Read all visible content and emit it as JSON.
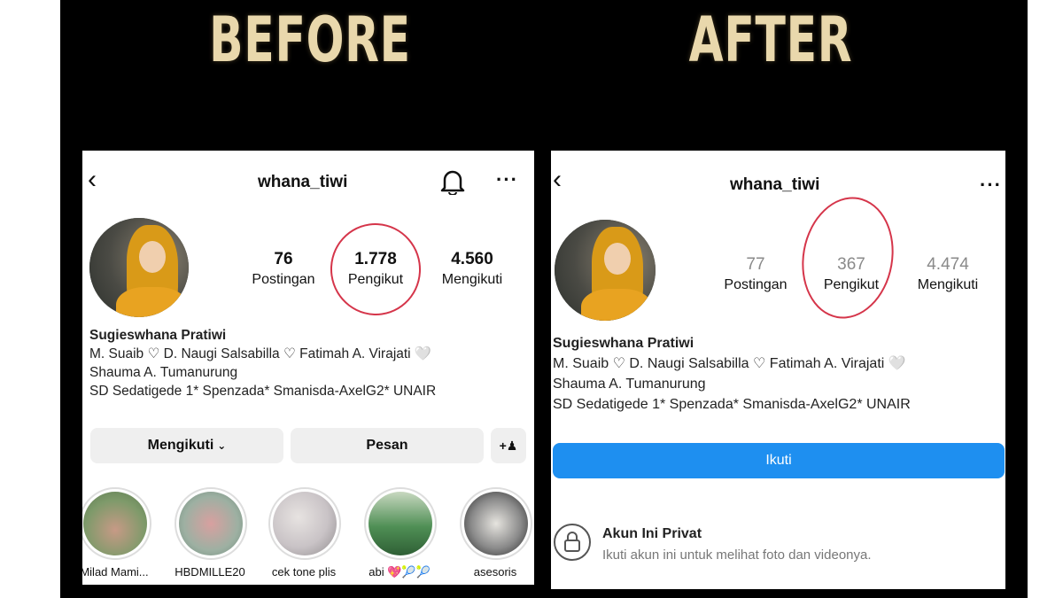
{
  "headings": {
    "before": "BEFORE",
    "after": "AFTER"
  },
  "before": {
    "username": "whana_tiwi",
    "stats": [
      {
        "value": "76",
        "label": "Postingan"
      },
      {
        "value": "1.778",
        "label": "Pengikut"
      },
      {
        "value": "4.560",
        "label": "Mengikuti"
      }
    ],
    "bio": {
      "name": "Sugieswhana Pratiwi",
      "line1": "M. Suaib ♡ D. Naugi Salsabilla ♡ Fatimah A. Virajati 🤍",
      "line2": "Shauma A. Tumanurung",
      "line3": "SD Sedatigede 1* Spenzada* Smanisda-AxelG2* UNAIR"
    },
    "buttons": {
      "following": "Mengikuti",
      "message": "Pesan"
    },
    "highlights": [
      {
        "label": "Milad Mami...",
        "color": "#7e9a6a"
      },
      {
        "label": "HBDMILLE20",
        "color": "#9db0a2"
      },
      {
        "label": "cek tone plis",
        "color": "#c9c3c6"
      },
      {
        "label": "abi 💖🎾🎾",
        "color": "#4f8f55"
      },
      {
        "label": "asesoris",
        "color": "#5a5a5a"
      }
    ]
  },
  "after": {
    "username": "whana_tiwi",
    "stats": [
      {
        "value": "77",
        "label": "Postingan"
      },
      {
        "value": "367",
        "label": "Pengikut"
      },
      {
        "value": "4.474",
        "label": "Mengikuti"
      }
    ],
    "bio": {
      "name": "Sugieswhana Pratiwi",
      "line1": "M. Suaib ♡ D. Naugi Salsabilla ♡ Fatimah A. Virajati 🤍",
      "line2": "Shauma A. Tumanurung",
      "line3": "SD Sedatigede 1* Spenzada* Smanisda-AxelG2* UNAIR"
    },
    "follow_button": "Ikuti",
    "private": {
      "title": "Akun Ini Privat",
      "subtitle": "Ikuti akun ini untuk melihat foto dan videonya."
    }
  },
  "colors": {
    "accent_blue": "#1e8ff0",
    "annotation_red": "#d5354a",
    "heading_gold": "#e9d8ac"
  }
}
